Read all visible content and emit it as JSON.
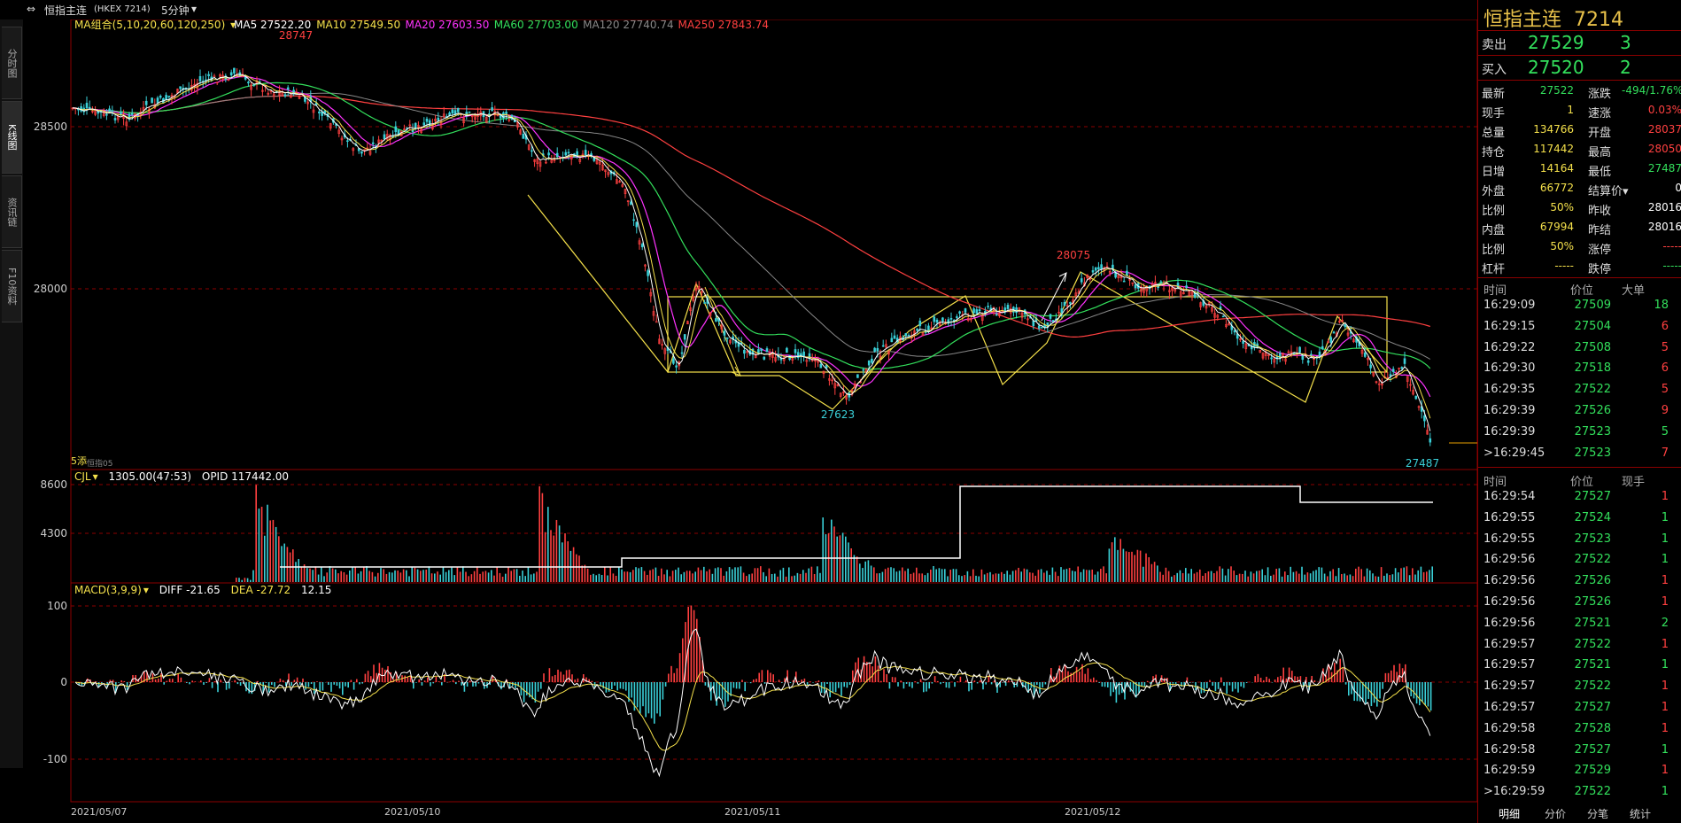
{
  "topbar": {
    "icon_text": "⇔",
    "instrument": "恒指主连",
    "code": "(HKEX 7214)",
    "period": "5分钟",
    "chevron": "▾"
  },
  "sidetabs": [
    "分时图",
    "K线图",
    "资讯链",
    "F10资料"
  ],
  "ma_legend": {
    "label": "MA组合(5,10,20,60,120,250)",
    "items": [
      {
        "name": "MA5",
        "value": "27522.20",
        "color": "#ffffff"
      },
      {
        "name": "MA10",
        "value": "27549.50",
        "color": "#f5e14b"
      },
      {
        "name": "MA20",
        "value": "27603.50",
        "color": "#ff33ff"
      },
      {
        "name": "MA60",
        "value": "27703.00",
        "color": "#33e05c"
      },
      {
        "name": "MA120",
        "value": "27740.74",
        "color": "#888888"
      },
      {
        "name": "MA250",
        "value": "27843.74",
        "color": "#ff4040"
      }
    ]
  },
  "price_axis": [
    "28500",
    "28000"
  ],
  "annotations": {
    "high": "28747",
    "mid_high": "28075",
    "low1": "27623",
    "low2": "27487",
    "bottom_left_tag": "5添",
    "bottom_left_sub": "恒指05"
  },
  "vol_panel": {
    "label": "CJL",
    "value": "1305.00(47:53)",
    "opid": "OPID 117442.00",
    "axis": [
      "8600",
      "4300"
    ]
  },
  "macd_panel": {
    "label": "MACD(3,9,9)",
    "diff": "DIFF -21.65",
    "dea": "DEA -27.72",
    "macd": "12.15",
    "axis": [
      "100",
      "0",
      "-100"
    ]
  },
  "dates": [
    "2021/05/07",
    "2021/05/10",
    "2021/05/11",
    "2021/05/12"
  ],
  "quote": {
    "title": "恒指主连",
    "code": "7214",
    "sell_label": "卖出",
    "sell_price": "27529",
    "sell_qty": "3",
    "buy_label": "买入",
    "buy_price": "27520",
    "buy_qty": "2",
    "rows": [
      {
        "l1": "最新",
        "v1": "27522",
        "c1": "#33e05c",
        "l2": "涨跌",
        "v2": "-494/1.76%",
        "c2": "#33e05c"
      },
      {
        "l1": "现手",
        "v1": "1",
        "c1": "#f5e14b",
        "l2": "速涨",
        "v2": "0.03%",
        "c2": "#ff4040"
      },
      {
        "l1": "总量",
        "v1": "134766",
        "c1": "#f5e14b",
        "l2": "开盘",
        "v2": "28037",
        "c2": "#ff4040"
      },
      {
        "l1": "持仓",
        "v1": "117442",
        "c1": "#f5e14b",
        "l2": "最高",
        "v2": "28050",
        "c2": "#ff4040"
      },
      {
        "l1": "日增",
        "v1": "14164",
        "c1": "#f5e14b",
        "l2": "最低",
        "v2": "27487",
        "c2": "#33e05c"
      },
      {
        "l1": "外盘",
        "v1": "66772",
        "c1": "#f5e14b",
        "l2": "结算价▾",
        "v2": "0",
        "c2": "#ffffff"
      },
      {
        "l1": "比例",
        "v1": "50%",
        "c1": "#f5e14b",
        "l2": "昨收",
        "v2": "28016",
        "c2": "#ffffff"
      },
      {
        "l1": "内盘",
        "v1": "67994",
        "c1": "#f5e14b",
        "l2": "昨结",
        "v2": "28016",
        "c2": "#ffffff"
      },
      {
        "l1": "比例",
        "v1": "50%",
        "c1": "#f5e14b",
        "l2": "涨停",
        "v2": "-----",
        "c2": "#ff4040"
      },
      {
        "l1": "杠杆",
        "v1": "-----",
        "c1": "#f5e14b",
        "l2": "跌停",
        "v2": "-----",
        "c2": "#33e05c"
      }
    ]
  },
  "table1": {
    "headers": [
      "时间",
      "价位",
      "大单"
    ],
    "rows": [
      {
        "t": "16:29:09",
        "p": "27509",
        "v": "18",
        "c": "#33e05c"
      },
      {
        "t": "16:29:15",
        "p": "27504",
        "v": "6",
        "c": "#ff4040"
      },
      {
        "t": "16:29:22",
        "p": "27508",
        "v": "5",
        "c": "#ff4040"
      },
      {
        "t": "16:29:30",
        "p": "27518",
        "v": "6",
        "c": "#ff4040"
      },
      {
        "t": "16:29:35",
        "p": "27522",
        "v": "5",
        "c": "#ff4040"
      },
      {
        "t": "16:29:39",
        "p": "27526",
        "v": "9",
        "c": "#ff4040"
      },
      {
        "t": "16:29:39",
        "p": "27523",
        "v": "5",
        "c": "#33e05c"
      },
      {
        "t": ">16:29:45",
        "p": "27523",
        "v": "7",
        "c": "#ff4040"
      }
    ]
  },
  "table2": {
    "headers": [
      "时间",
      "价位",
      "现手"
    ],
    "rows": [
      {
        "t": "16:29:54",
        "p": "27527",
        "v": "1",
        "c": "#ff4040"
      },
      {
        "t": "16:29:55",
        "p": "27524",
        "v": "1",
        "c": "#33e05c"
      },
      {
        "t": "16:29:55",
        "p": "27523",
        "v": "1",
        "c": "#33e05c"
      },
      {
        "t": "16:29:56",
        "p": "27522",
        "v": "1",
        "c": "#33e05c"
      },
      {
        "t": "16:29:56",
        "p": "27526",
        "v": "1",
        "c": "#ff4040"
      },
      {
        "t": "16:29:56",
        "p": "27526",
        "v": "1",
        "c": "#ff4040"
      },
      {
        "t": "16:29:56",
        "p": "27521",
        "v": "2",
        "c": "#33e05c"
      },
      {
        "t": "16:29:57",
        "p": "27522",
        "v": "1",
        "c": "#ff4040"
      },
      {
        "t": "16:29:57",
        "p": "27521",
        "v": "1",
        "c": "#33e05c"
      },
      {
        "t": "16:29:57",
        "p": "27522",
        "v": "1",
        "c": "#ff4040"
      },
      {
        "t": "16:29:57",
        "p": "27527",
        "v": "1",
        "c": "#ff4040"
      },
      {
        "t": "16:29:58",
        "p": "27528",
        "v": "1",
        "c": "#ff4040"
      },
      {
        "t": "16:29:58",
        "p": "27527",
        "v": "1",
        "c": "#33e05c"
      },
      {
        "t": "16:29:59",
        "p": "27529",
        "v": "1",
        "c": "#ff4040"
      },
      {
        "t": ">16:29:59",
        "p": "27522",
        "v": "1",
        "c": "#33e05c"
      }
    ]
  },
  "bottom_tabs": [
    "明细",
    "分价",
    "分笔",
    "统计"
  ]
}
